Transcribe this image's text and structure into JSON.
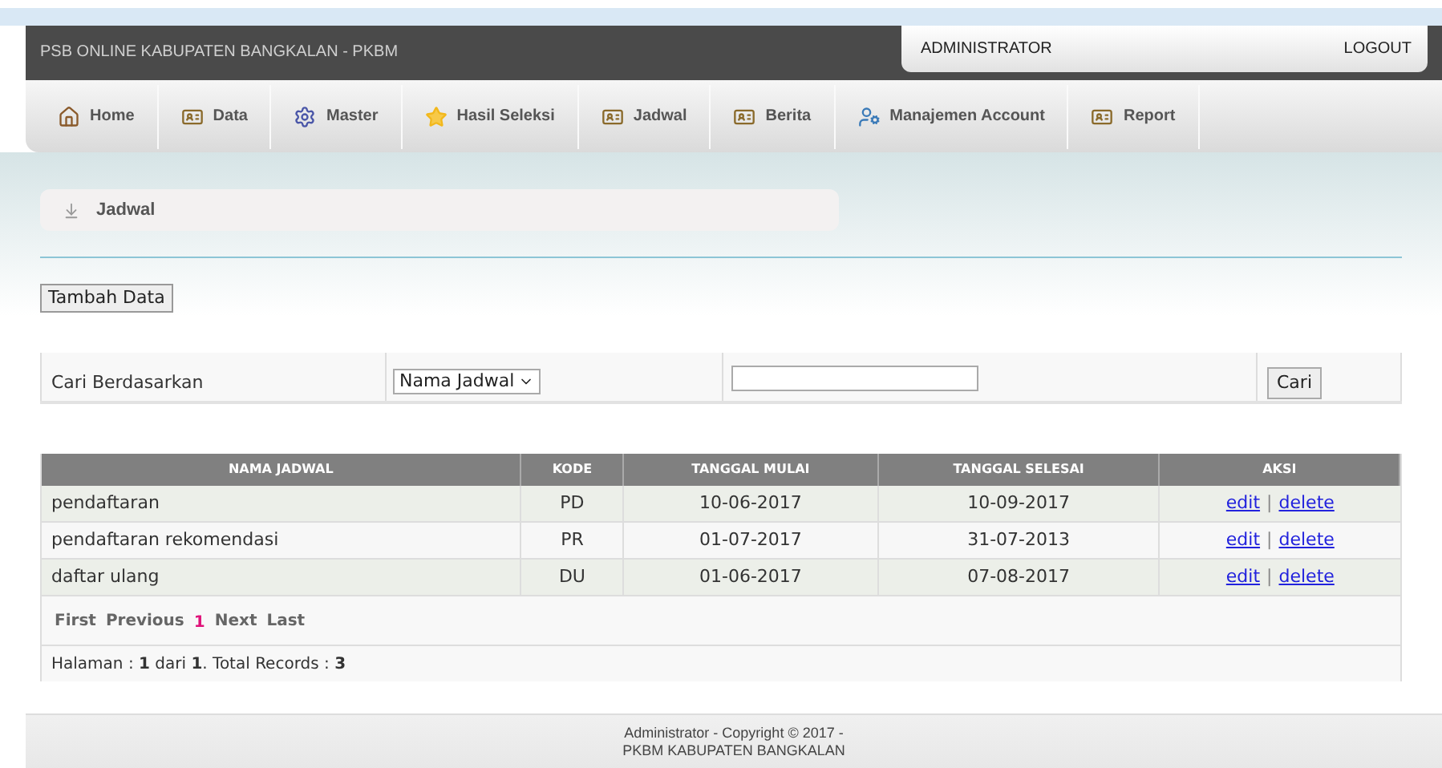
{
  "header": {
    "title": "PSB ONLINE KABUPATEN BANGKALAN - PKBM",
    "user": "ADMINISTRATOR",
    "logout": "LOGOUT"
  },
  "menu": [
    {
      "label": "Home",
      "kind": "home"
    },
    {
      "label": "Data",
      "kind": "card"
    },
    {
      "label": "Master",
      "kind": "gear"
    },
    {
      "label": "Hasil Seleksi",
      "kind": "star"
    },
    {
      "label": "Jadwal",
      "kind": "card"
    },
    {
      "label": "Berita",
      "kind": "card"
    },
    {
      "label": "Manajemen Account",
      "kind": "user"
    },
    {
      "label": "Report",
      "kind": "card"
    }
  ],
  "breadcrumb": "Jadwal",
  "add_button": "Tambah Data",
  "search": {
    "label": "Cari Berdasarkan",
    "select_value": "Nama Jadwal",
    "button": "Cari"
  },
  "table": {
    "columns": [
      "NAMA JADWAL",
      "KODE",
      "TANGGAL MULAI",
      "TANGGAL SELESAI",
      "AKSI"
    ],
    "rows": [
      {
        "name": "pendaftaran",
        "code": "PD",
        "start": "10-06-2017",
        "end": "10-09-2017",
        "edit": "edit",
        "separator": "|",
        "delete": "delete"
      },
      {
        "name": "pendaftaran rekomendasi",
        "code": "PR",
        "start": "01-07-2017",
        "end": "31-07-2013",
        "edit": "edit",
        "separator": "|",
        "delete": "delete"
      },
      {
        "name": "daftar ulang",
        "code": "DU",
        "start": "01-06-2017",
        "end": "07-08-2017",
        "edit": "edit",
        "separator": "|",
        "delete": "delete"
      }
    ]
  },
  "pagination": [
    {
      "label": "First",
      "selected": false
    },
    {
      "label": "Previous",
      "selected": false
    },
    {
      "label": "1",
      "selected": true
    },
    {
      "label": "Next",
      "selected": false
    },
    {
      "label": "Last",
      "selected": false
    }
  ],
  "summary": "Halaman : **1** dari **1**. Total Records : **3**",
  "footer": [
    "Administrator - Copyright © 2017 -",
    "PKBM KABUPATEN BANGKALAN"
  ]
}
